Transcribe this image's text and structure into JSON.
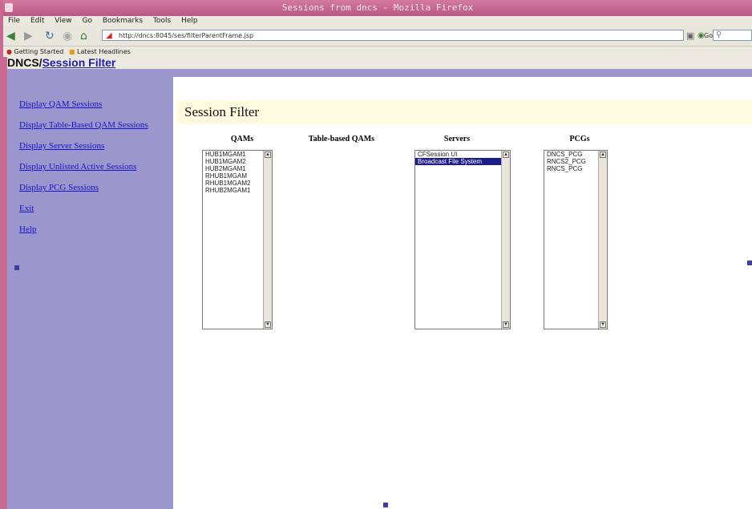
{
  "window": {
    "title": "Sessions from dncs - Mozilla Firefox"
  },
  "menu": [
    "File",
    "Edit",
    "View",
    "Go",
    "Bookmarks",
    "Tools",
    "Help"
  ],
  "navigation": {
    "url": "http://dncs:8045/ses/filterParentFrame.jsp",
    "search_button": "Go",
    "search_placeholder": ""
  },
  "bookmarks": [
    "Getting Started",
    "Latest Headlines"
  ],
  "brand": {
    "prefix": "DNCS/",
    "link": "Session Filter"
  },
  "sidebar": {
    "links": [
      "Display QAM Sessions",
      "Display Table-Based QAM Sessions",
      "Display Server Sessions",
      "Display Unlisted Active Sessions",
      "Display PCG Sessions",
      "Exit",
      "Help"
    ]
  },
  "page": {
    "title": "Session Filter",
    "columns": {
      "qams": {
        "header": "QAMs",
        "options": [
          "HUB1MGAM1",
          "HUB1MGAM2",
          "HUB2MGAM1",
          "RHUB1MGAM",
          "RHUB1MGAM2",
          "RHUB2MGAM1"
        ]
      },
      "table_qams": {
        "header": "Table-based QAMs"
      },
      "servers": {
        "header": "Servers",
        "options": [
          "CFSession UI",
          "Broadcast File System"
        ],
        "selected": "Broadcast File System"
      },
      "pcgs": {
        "header": "PCGs",
        "options": [
          "DNCS_PCG",
          "RNCS2_PCG",
          "RNCS_PCG"
        ]
      }
    }
  }
}
